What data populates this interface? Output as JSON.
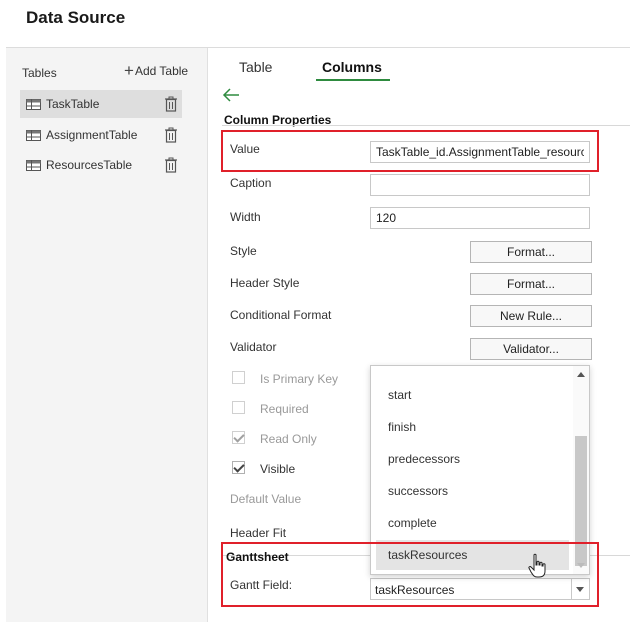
{
  "title": "Data Source",
  "sidebar": {
    "tables_label": "Tables",
    "add_table_label": "Add Table",
    "items": [
      {
        "name": "TaskTable"
      },
      {
        "name": "AssignmentTable"
      },
      {
        "name": "ResourcesTable"
      }
    ]
  },
  "tabs": {
    "table": "Table",
    "columns": "Columns"
  },
  "column_properties": {
    "heading": "Column Properties",
    "value_label": "Value",
    "value": "TaskTable_id.AssignmentTable_resource",
    "caption_label": "Caption",
    "caption_value": "",
    "width_label": "Width",
    "width_value": "120",
    "style_label": "Style",
    "style_button": "Format...",
    "header_style_label": "Header Style",
    "header_style_button": "Format...",
    "conditional_format_label": "Conditional Format",
    "conditional_format_button": "New Rule...",
    "validator_label": "Validator",
    "validator_button": "Validator...",
    "is_primary_key_label": "Is Primary Key",
    "required_label": "Required",
    "read_only_label": "Read Only",
    "visible_label": "Visible",
    "default_value_label": "Default Value",
    "header_fit_label": "Header Fit"
  },
  "ganttsheet": {
    "heading": "Ganttsheet",
    "gantt_field_label": "Gantt Field:",
    "gantt_field_value": "taskResources",
    "options": [
      "start",
      "finish",
      "predecessors",
      "successors",
      "complete",
      "taskResources"
    ]
  },
  "colors": {
    "accent": "#2e8b3f",
    "highlight_border": "#e0202a"
  }
}
